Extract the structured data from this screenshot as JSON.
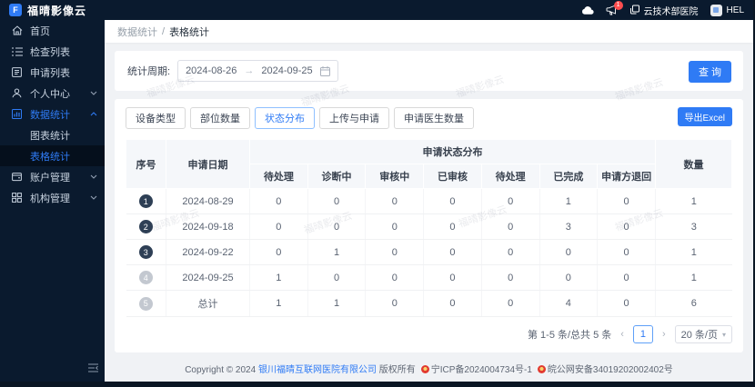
{
  "app": {
    "title": "福晴影像云",
    "logo_letter": "F"
  },
  "colors": {
    "accent": "#2f7bf5",
    "dark_nav": "#0a1a2e",
    "badge_red": "#ff4d4f"
  },
  "header": {
    "notice_badge": "1",
    "org_name": "云技术部医院",
    "user_name": "HEL"
  },
  "sidebar": {
    "items": [
      {
        "key": "home",
        "label": "首页",
        "icon": "home-icon"
      },
      {
        "key": "exam-list",
        "label": "检查列表",
        "icon": "list-icon"
      },
      {
        "key": "apply-list",
        "label": "申请列表",
        "icon": "document-icon"
      },
      {
        "key": "personal-center",
        "label": "个人中心",
        "icon": "user-icon",
        "chevron": "down"
      },
      {
        "key": "data-statistics",
        "label": "数据统计",
        "icon": "chart-icon",
        "chevron": "up",
        "parentActive": true
      },
      {
        "key": "chart-statistics",
        "label": "图表统计",
        "sub": true
      },
      {
        "key": "table-statistics",
        "label": "表格统计",
        "sub": true,
        "active": true
      },
      {
        "key": "account-management",
        "label": "账户管理",
        "icon": "wallet-icon",
        "chevron": "down"
      },
      {
        "key": "org-management",
        "label": "机构管理",
        "icon": "grid-icon",
        "chevron": "down"
      }
    ]
  },
  "breadcrumb": {
    "parent": "数据统计",
    "separator": "/",
    "current": "表格统计"
  },
  "filter": {
    "label": "统计周期:",
    "start_date": "2024-08-26",
    "arrow": "→",
    "end_date": "2024-09-25",
    "query_label": "查 询"
  },
  "tabs": {
    "active_index": 2,
    "items": [
      {
        "key": "device-type",
        "label": "设备类型"
      },
      {
        "key": "part-count",
        "label": "部位数量"
      },
      {
        "key": "status-distribution",
        "label": "状态分布"
      },
      {
        "key": "upload-apply",
        "label": "上传与申请"
      },
      {
        "key": "apply-doctor-count",
        "label": "申请医生数量"
      }
    ]
  },
  "export_label": "导出Excel",
  "table": {
    "columns": {
      "index": "序号",
      "date": "申请日期",
      "status_group": "申请状态分布",
      "status_columns": [
        "待处理",
        "诊断中",
        "审核中",
        "已审核",
        "待处理",
        "已完成",
        "申请方退回"
      ],
      "count": "数量"
    },
    "rows": [
      {
        "index": "1",
        "badge": "dark",
        "date": "2024-08-29",
        "statuses": [
          "0",
          "0",
          "0",
          "0",
          "0",
          "1",
          "0"
        ],
        "count": "1"
      },
      {
        "index": "2",
        "badge": "dark",
        "date": "2024-09-18",
        "statuses": [
          "0",
          "0",
          "0",
          "0",
          "0",
          "3",
          "0"
        ],
        "count": "3"
      },
      {
        "index": "3",
        "badge": "dark",
        "date": "2024-09-22",
        "statuses": [
          "0",
          "1",
          "0",
          "0",
          "0",
          "0",
          "0"
        ],
        "count": "1"
      },
      {
        "index": "4",
        "badge": "gray",
        "date": "2024-09-25",
        "statuses": [
          "1",
          "0",
          "0",
          "0",
          "0",
          "0",
          "0"
        ],
        "count": "1"
      },
      {
        "index": "5",
        "badge": "gray",
        "date": "总计",
        "statuses": [
          "1",
          "1",
          "0",
          "0",
          "0",
          "4",
          "0"
        ],
        "count": "6"
      }
    ]
  },
  "pagination": {
    "summary": "第 1-5 条/总共 5 条",
    "prev": "‹",
    "page": "1",
    "next": "›",
    "page_size": "20 条/页"
  },
  "footer": {
    "prefix": "Copyright © 2024 ",
    "company": "银川福晴互联网医院有限公司",
    "rights": " 版权所有",
    "icp": "宁ICP备2024004734号-1",
    "security": "皖公网安备34019202002402号"
  },
  "watermark": "福晴影像云"
}
